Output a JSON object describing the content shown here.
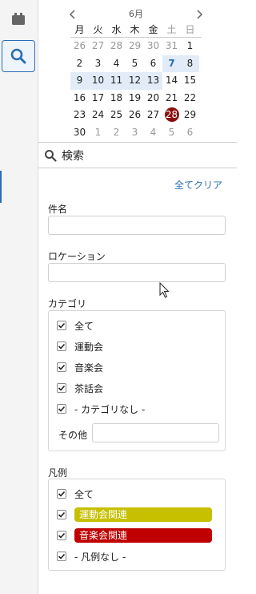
{
  "calendar": {
    "month_label": "6月",
    "weekdays": [
      "月",
      "火",
      "水",
      "木",
      "金",
      "土",
      "日"
    ],
    "weeks": [
      [
        "26",
        "27",
        "28",
        "29",
        "30",
        "31",
        "1"
      ],
      [
        "2",
        "3",
        "4",
        "5",
        "6",
        "7",
        "8"
      ],
      [
        "9",
        "10",
        "11",
        "12",
        "13",
        "14",
        "15"
      ],
      [
        "16",
        "17",
        "18",
        "19",
        "20",
        "21",
        "22"
      ],
      [
        "23",
        "24",
        "25",
        "26",
        "27",
        "28",
        "29"
      ],
      [
        "30",
        "1",
        "2",
        "3",
        "4",
        "5",
        "6"
      ]
    ]
  },
  "search": {
    "title": "検索",
    "clear_all": "全てクリア",
    "subject_label": "件名",
    "location_label": "ロケーション",
    "category_label": "カテゴリ",
    "categories": [
      "全て",
      "運動会",
      "音楽会",
      "茶話会",
      "- カテゴリなし -"
    ],
    "other_label": "その他",
    "legend_label": "凡例",
    "legend_items": [
      {
        "label": "全て"
      },
      {
        "label": "運動会関連",
        "color": "#c6c000",
        "text_color": "#ffffff"
      },
      {
        "label": "音楽会関連",
        "color": "#c00000",
        "text_color": "#ffffff"
      },
      {
        "label": "- 凡例なし -"
      }
    ]
  },
  "colors": {
    "accent": "#2a6db5",
    "today": "#8b0e0e"
  }
}
